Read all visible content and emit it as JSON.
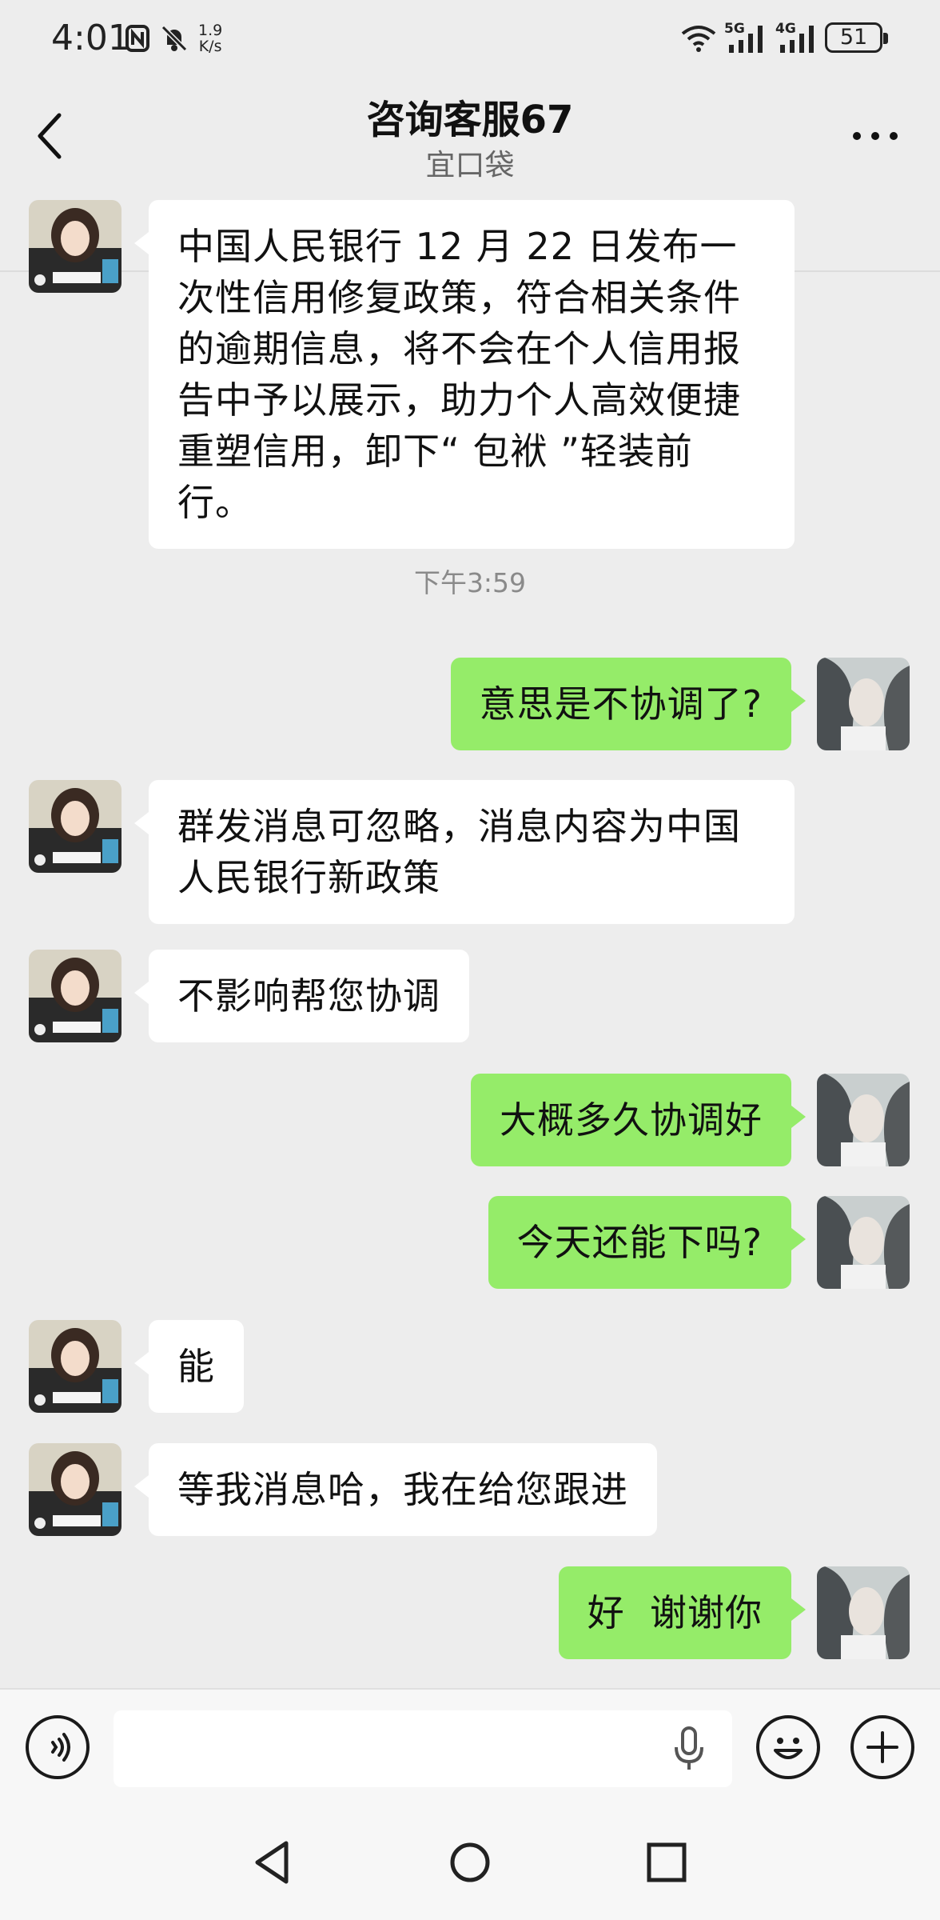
{
  "status_bar": {
    "time": "4:01",
    "speed_value": "1.9",
    "speed_unit": "K/s",
    "network_1": "5G",
    "network_2": "4G",
    "battery": "51"
  },
  "header": {
    "title": "咨询客服67",
    "subtitle": "宜口袋",
    "back_icon": "chevron-left-icon",
    "more_icon": "more-dots-icon"
  },
  "messages": [
    {
      "side": "in",
      "text": "中国人民银行 12 月 22 日发布一次性信用修复政策，符合相关条件的逾期信息，将不会在个人信用报告中予以展示，助力个人高效便捷重塑信用，卸下“ 包袱 ”轻装前行。"
    },
    {
      "side": "out",
      "text": "意思是不协调了?"
    },
    {
      "side": "in",
      "text": "群发消息可忽略，消息内容为中国人民银行新政策"
    },
    {
      "side": "in",
      "text": "不影响帮您协调"
    },
    {
      "side": "out",
      "text": "大概多久协调好"
    },
    {
      "side": "out",
      "text": "今天还能下吗?"
    },
    {
      "side": "in",
      "text": "能"
    },
    {
      "side": "in",
      "text": "等我消息哈，我在给您跟进"
    },
    {
      "side": "out",
      "text": "好  谢谢你"
    }
  ],
  "time_separator": "下午3:59",
  "input_bar": {
    "voice_icon": "voice-icon",
    "mic_icon": "microphone-icon",
    "emoji_icon": "emoji-icon",
    "plus_icon": "plus-icon",
    "value": "",
    "placeholder": ""
  },
  "colors": {
    "background": "#ededed",
    "incoming_bubble": "#ffffff",
    "outgoing_bubble": "#95ec69"
  }
}
